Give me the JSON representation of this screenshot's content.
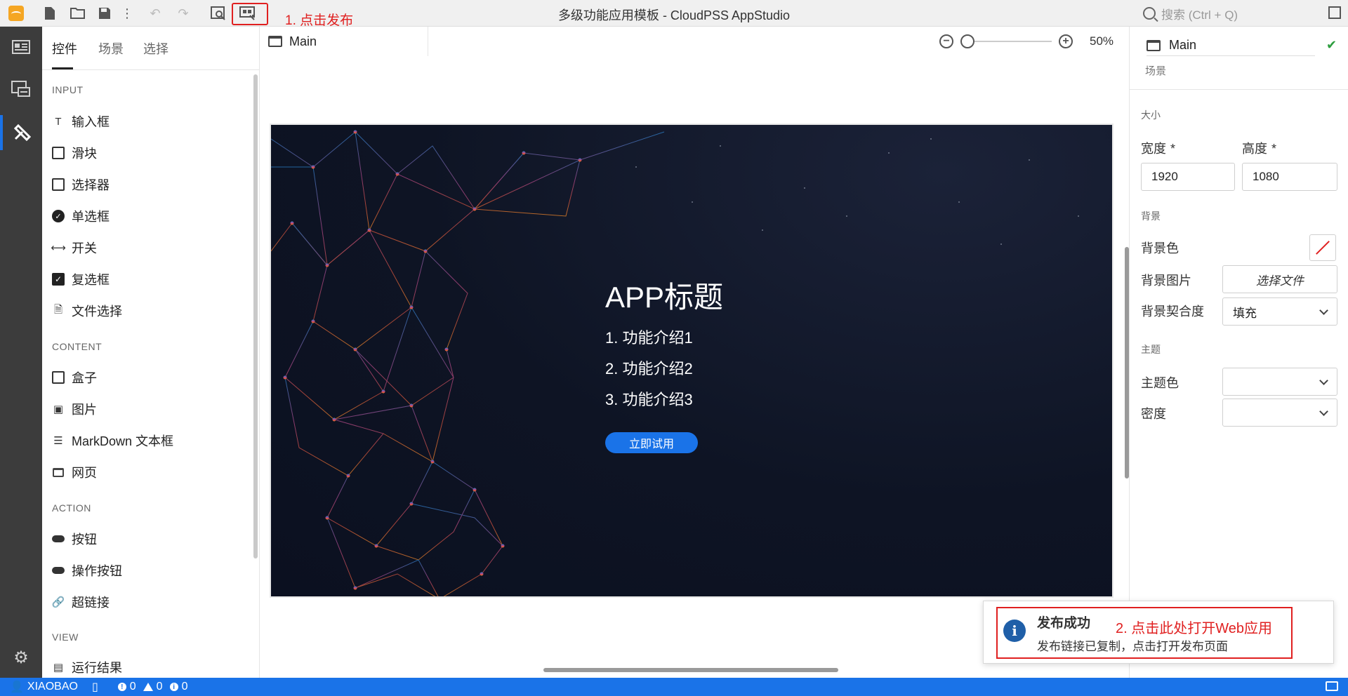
{
  "window": {
    "title": "多级功能应用模板 - CloudPSS AppStudio"
  },
  "toolbar": {
    "annotation_publish": "1. 点击发布",
    "search_placeholder": "搜索 (Ctrl + Q)",
    "icons": [
      "app-logo",
      "new-file-icon",
      "open-folder-icon",
      "save-icon",
      "more-icon",
      "undo-icon",
      "redo-icon",
      "preview-icon",
      "publish-icon",
      "maximize-icon"
    ]
  },
  "left_panel": {
    "tabs": [
      "控件",
      "场景",
      "选择"
    ],
    "sections": {
      "input": {
        "title": "INPUT",
        "items": [
          "输入框",
          "滑块",
          "选择器",
          "单选框",
          "开关",
          "复选框",
          "文件选择"
        ]
      },
      "content": {
        "title": "CONTENT",
        "items": [
          "盒子",
          "图片",
          "MarkDown 文本框",
          "网页"
        ]
      },
      "action": {
        "title": "ACTION",
        "items": [
          "按钮",
          "操作按钮",
          "超链接"
        ]
      },
      "view": {
        "title": "VIEW",
        "items": [
          "运行结果"
        ]
      }
    }
  },
  "editor": {
    "tab": "Main",
    "zoom": "50%",
    "zoom_level": 0.0,
    "canvas": {
      "title": "APP标题",
      "features": [
        "1. 功能介绍1",
        "2. 功能介绍2",
        "3. 功能介绍3"
      ],
      "button": "立即试用"
    }
  },
  "right_panel": {
    "name": "Main",
    "subtitle": "场景",
    "size": {
      "title": "大小",
      "width_label": "宽度",
      "height_label": "高度",
      "required": "*",
      "width": "1920",
      "height": "1080"
    },
    "background": {
      "title": "背景",
      "color_label": "背景色",
      "image_label": "背景图片",
      "image_button": "选择文件",
      "fit_label": "背景契合度",
      "fit_value": "填充"
    },
    "theme": {
      "title": "主题",
      "color_label": "主题色",
      "color_value": "",
      "density_label": "密度",
      "density_value": ""
    }
  },
  "notification": {
    "title": "发布成功",
    "body": "发布链接已复制，点击打开发布页面",
    "annotation": "2. 点击此处打开Web应用"
  },
  "statusbar": {
    "user": "XIAOBAO",
    "errors": "0",
    "warnings": "0",
    "infos": "0"
  },
  "colors": {
    "accent": "#1a73e8",
    "annotation": "#e02020",
    "activity_bar": "#3c3c3c",
    "canvas_bg": "#0e1424"
  }
}
